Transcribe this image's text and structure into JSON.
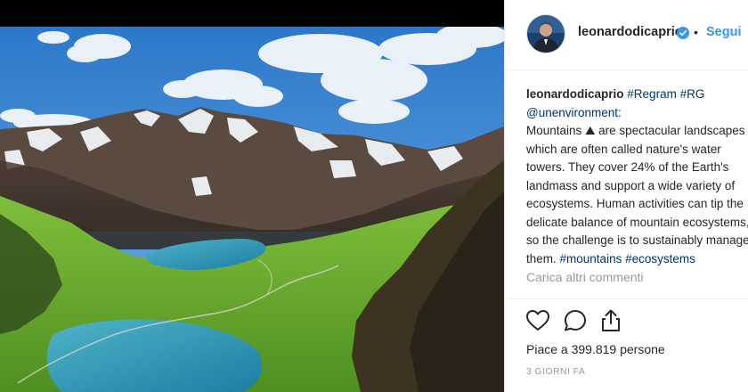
{
  "post": {
    "username": "leonardodicaprio",
    "separator": "•",
    "follow_label": "Segui",
    "verified_icon": "verified-badge-icon",
    "caption": {
      "username": "leonardodicaprio",
      "hashtag_regram": "#Regram",
      "hashtag_rg": "#RG",
      "mention": "@unenvironment",
      "colon": ":",
      "line1": "Mountains",
      "mountain_emoji": "⛰",
      "line1_rest": "are spectacular landscapes",
      "line2": "which are often called nature's water",
      "line3": "towers. They cover 24% of the Earth's",
      "line4": "landmass and support a wide variety of",
      "line5": "ecosystems. Human activities can tip the",
      "line6": "delicate balance of mountain ecosystems,",
      "line7": "so the challenge is to sustainably manage",
      "line8_start": "them.",
      "hashtag_mountains": "#mountains",
      "hashtag_ecosystems": "#ecosystems"
    },
    "load_more_label": "Carica altri commenti",
    "actions": {
      "like_icon": "heart-icon",
      "comment_icon": "comment-icon",
      "share_icon": "share-icon"
    },
    "likes_text": "Piace a 399.819 persone",
    "date": "3 GIORNI FA"
  },
  "colors": {
    "link": "#003569",
    "follow": "#3897f0",
    "verified": "#3897f0",
    "muted": "#999999",
    "text": "#262626"
  }
}
